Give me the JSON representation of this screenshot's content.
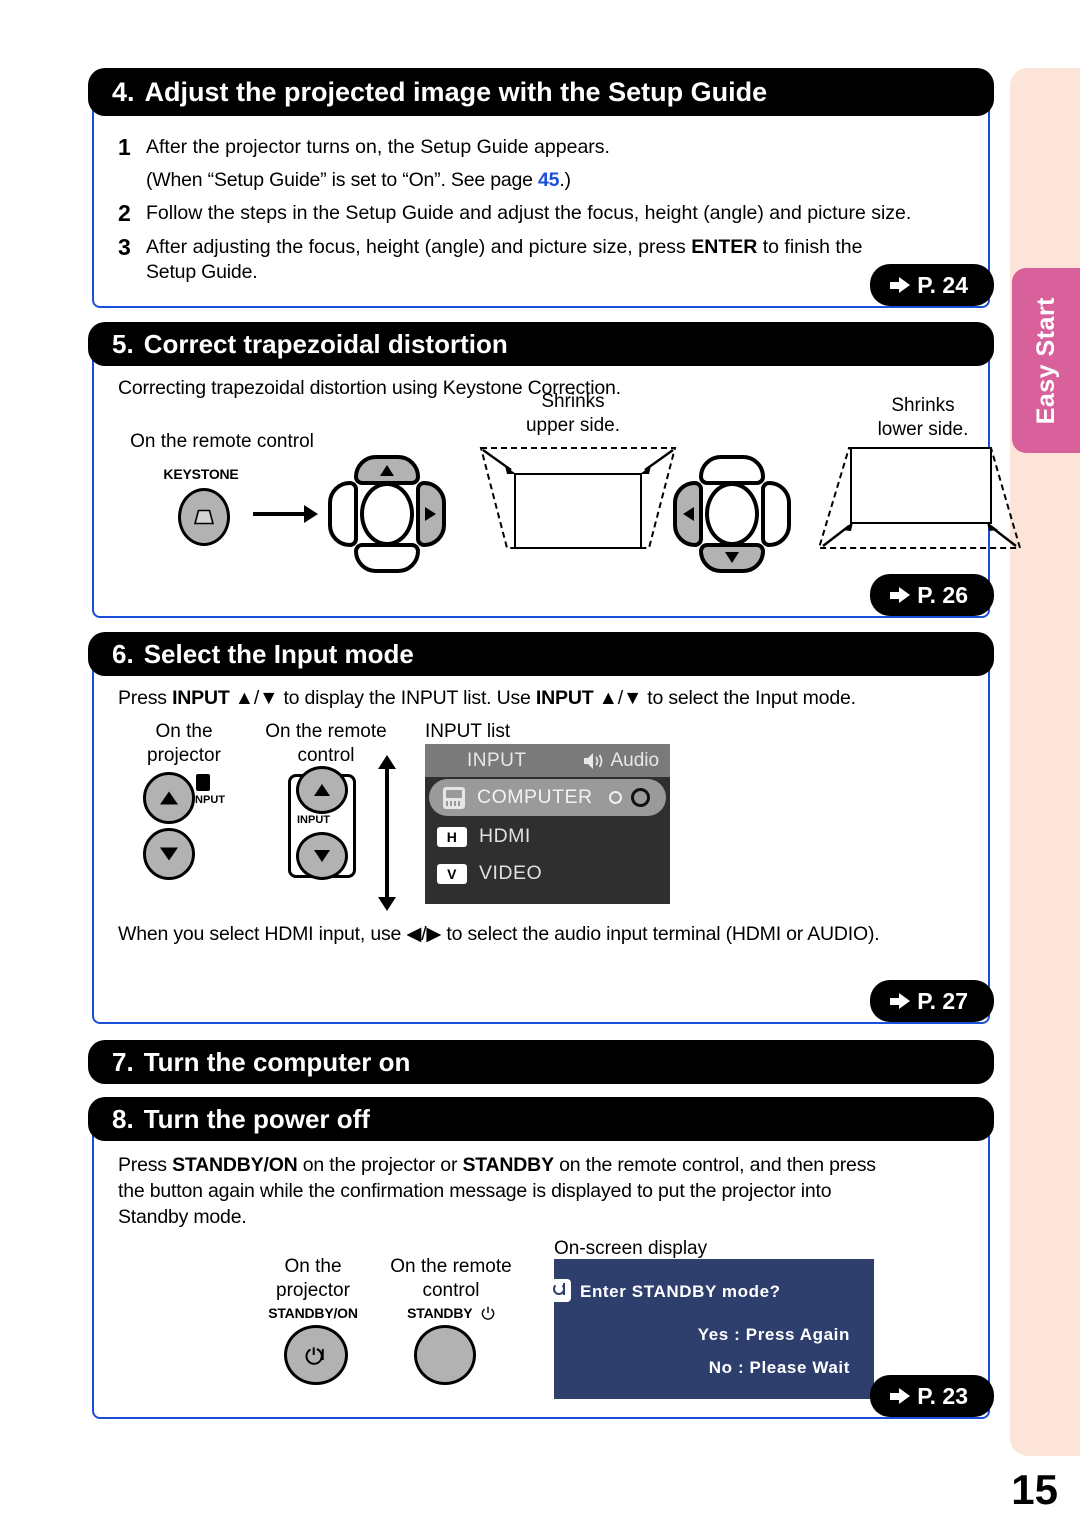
{
  "page": {
    "number": "15",
    "side_tab": "Easy Start"
  },
  "sections": {
    "s4": {
      "num": "4.",
      "title": "Adjust the projected image with the Setup Guide",
      "steps": [
        {
          "n": "1",
          "line1": "After the projector turns on, the Setup Guide appears.",
          "line2_a": "(When “Setup Guide” is set to “On”. See page ",
          "line2_ref": "45",
          "line2_b": ".)"
        },
        {
          "n": "2",
          "line1": "Follow the steps in the Setup Guide and adjust the focus, height (angle) and picture size."
        },
        {
          "n": "3",
          "line1_a": "After adjusting the focus, height (angle) and picture size, press ",
          "line1_bold": "ENTER",
          "line1_b": " to finish the",
          "line2": "Setup Guide."
        }
      ],
      "page_ref": "P. 24"
    },
    "s5": {
      "num": "5.",
      "title": "Correct trapezoidal distortion",
      "intro": "Correcting trapezoidal distortion using Keystone Correction.",
      "remote_label": "On the remote control",
      "keystone_label": "KEYSTONE",
      "shrink_upper": "Shrinks\nupper side.",
      "shrink_upper_l1": "Shrinks",
      "shrink_upper_l2": "upper side.",
      "shrink_lower_l1": "Shrinks",
      "shrink_lower_l2": "lower side.",
      "page_ref": "P. 26"
    },
    "s6": {
      "num": "6.",
      "title": "Select the Input mode",
      "intro_a": "Press ",
      "intro_b1": "INPUT",
      "intro_c": " ▲/▼ to display the INPUT list. Use ",
      "intro_b2": "INPUT",
      "intro_d": " ▲/▼ to select the Input mode.",
      "label_projector_l1": "On the",
      "label_projector_l2": "projector",
      "label_remote_l1": "On the remote",
      "label_remote_l2": "control",
      "label_inputlist": "INPUT list",
      "btn_input_label": "INPUT",
      "osd": {
        "header_title": "INPUT",
        "header_audio": "Audio",
        "rows": [
          {
            "tag": "",
            "label": "COMPUTER",
            "selected": true
          },
          {
            "tag": "H",
            "label": "HDMI",
            "selected": false
          },
          {
            "tag": "V",
            "label": "VIDEO",
            "selected": false
          }
        ]
      },
      "footnote": "When you select HDMI input, use ◀/▶ to select the audio input terminal (HDMI or AUDIO).",
      "page_ref": "P. 27"
    },
    "s7": {
      "num": "7.",
      "title": "Turn the computer on"
    },
    "s8": {
      "num": "8.",
      "title": "Turn the power off",
      "body_a": "Press ",
      "body_b1": "STANDBY/ON",
      "body_c": " on the projector or ",
      "body_b2": "STANDBY",
      "body_d": " on the remote control, and then press",
      "body_line2": "the button again while the confirmation message is displayed to put the projector into",
      "body_line3": "Standby mode.",
      "label_projector_l1": "On the",
      "label_projector_l2": "projector",
      "label_remote_l1": "On the remote",
      "label_remote_l2": "control",
      "label_osd": "On-screen display",
      "btn_projector_label": "STANDBY/ON",
      "btn_remote_label": "STANDBY",
      "osd": {
        "line1": "Enter STANDBY mode?",
        "line2": "Yes : Press Again",
        "line3": "No : Please Wait"
      },
      "page_ref": "P. 23"
    }
  },
  "colors": {
    "header_bar": "#000000",
    "box_border": "#1b4fd8",
    "link_blue": "#1a4fe0",
    "tab_pink": "#d9619b",
    "strip_peach": "#fce5d8",
    "osd_navy": "#2e3f6e",
    "osd_dark": "#2f2f2f",
    "osd_header_gray": "#7a7a7a",
    "button_gray": "#b2b2b2"
  }
}
